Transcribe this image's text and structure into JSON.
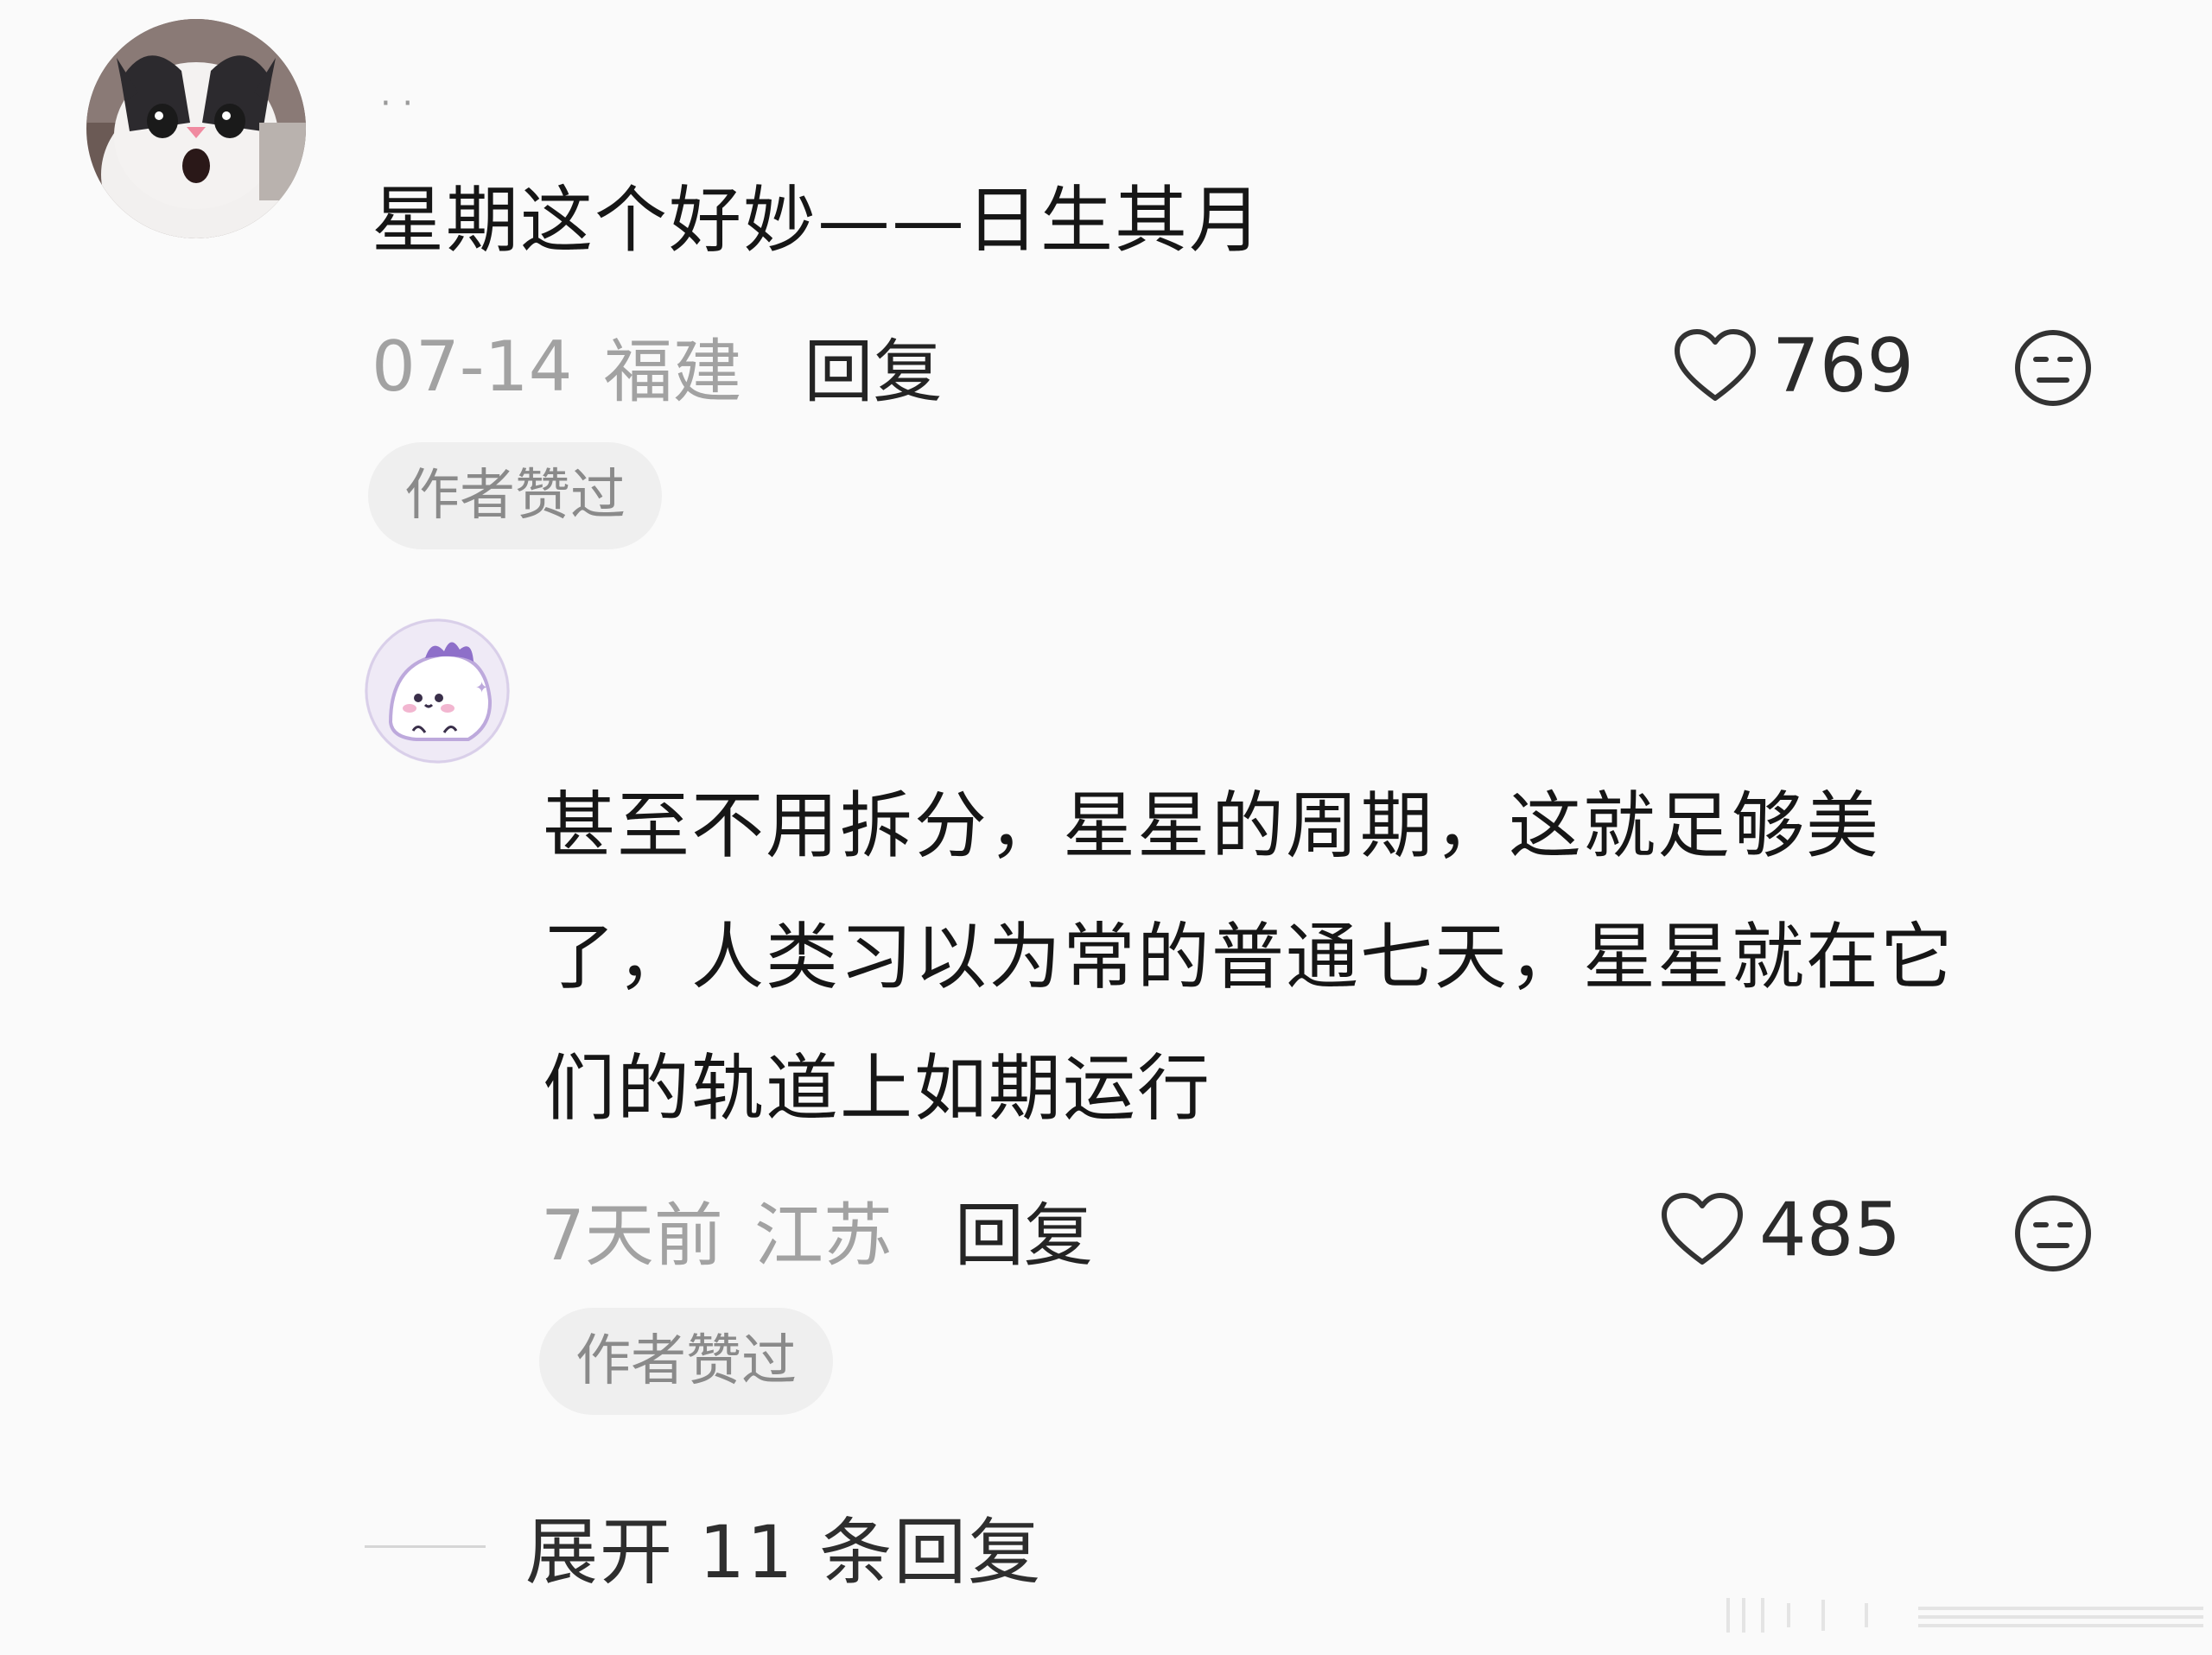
{
  "comments": [
    {
      "username": "· ·",
      "text": "星期这个好妙——日生其月",
      "date": "07-14",
      "location": "福建",
      "reply_label": "回复",
      "likes": "769",
      "badge": "作者赞过",
      "avatar_icon": "cat-avatar",
      "like_icon": "heart-outline-icon",
      "dislike_icon": "meh-face-icon"
    },
    {
      "text_lines": [
        "甚至不用拆分，星星的周期，这就足够美",
        "了，人类习以为常的普通七天，星星就在它",
        "们的轨道上如期运行"
      ],
      "date": "7天前",
      "location": "江苏",
      "reply_label": "回复",
      "likes": "485",
      "badge": "作者赞过",
      "avatar_icon": "purple-dino-avatar",
      "like_icon": "heart-outline-icon",
      "dislike_icon": "meh-face-icon"
    }
  ],
  "expand": {
    "label": "展开 11 条回复"
  },
  "colors": {
    "background": "#fafafa",
    "text": "#161616",
    "meta": "#a2a2a2",
    "badge_bg": "#efefef",
    "badge_text": "#8a8a8a"
  }
}
